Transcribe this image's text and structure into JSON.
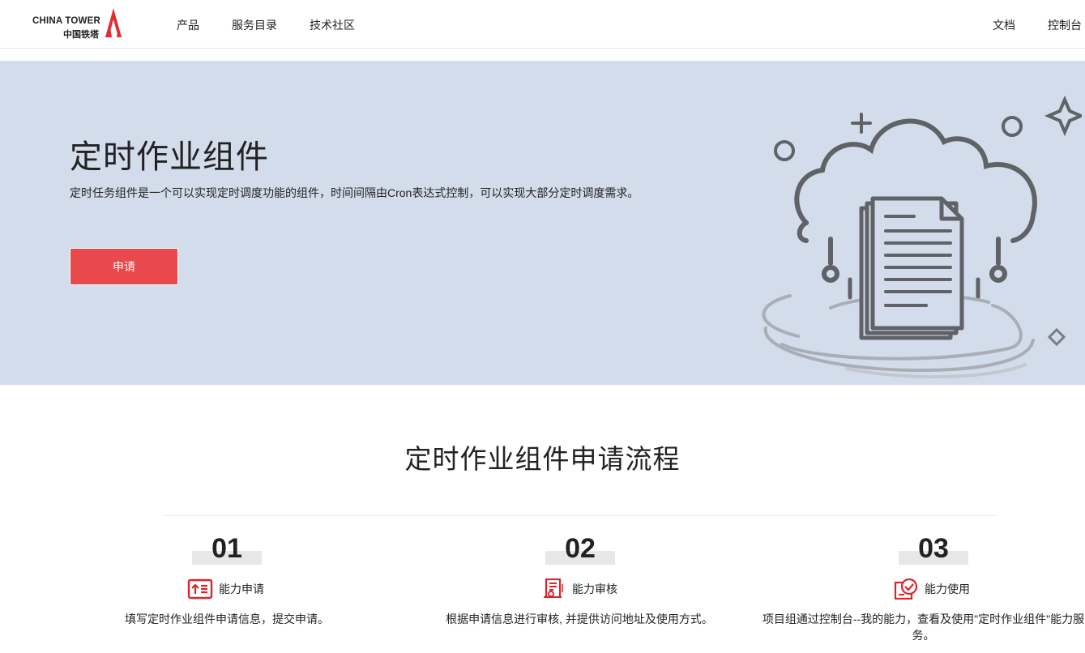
{
  "header": {
    "logo_en": "CHINA TOWER",
    "logo_cn": "中国铁塔",
    "nav": [
      "产品",
      "服务目录",
      "技术社区"
    ],
    "right_links": [
      "文档",
      "控制台"
    ]
  },
  "hero": {
    "title": "定时作业组件",
    "description": "定时任务组件是一个可以实现定时调度功能的组件，时间间隔由Cron表达式控制，可以实现大部分定时调度需求。",
    "apply_button": "申请"
  },
  "process": {
    "title": "定时作业组件申请流程",
    "steps": [
      {
        "number": "01",
        "label": "能力申请",
        "icon": "upload-form-icon",
        "description": "填写定时作业组件申请信息，提交申请。"
      },
      {
        "number": "02",
        "label": "能力审核",
        "icon": "document-review-icon",
        "description": "根据申请信息进行审核, 并提供访问地址及使用方式。"
      },
      {
        "number": "03",
        "label": "能力使用",
        "icon": "check-badge-icon",
        "description": "项目组通过控制台--我的能力，查看及使用\"定时作业组件\"能力服务。"
      }
    ]
  },
  "colors": {
    "accent": "#e9484d",
    "hero_bg": "#d3dceb",
    "icon_red": "#d9262c"
  }
}
